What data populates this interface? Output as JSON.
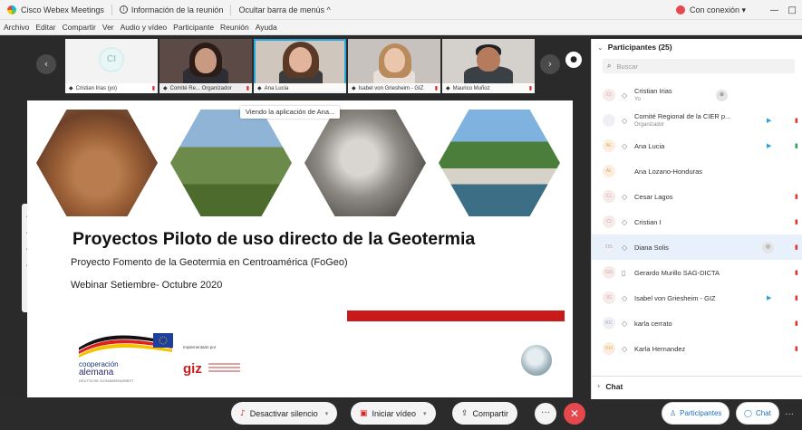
{
  "titlebar": {
    "app_name": "Cisco Webex Meetings",
    "meeting_info": "Información de la reunión",
    "hide_menu": "Ocultar barra de menús ^",
    "connection": "Con conexión ▾",
    "minimize": "—",
    "maximize": "□"
  },
  "menu": [
    "Archivo",
    "Editar",
    "Compartir",
    "Ver",
    "Audio y vídeo",
    "Participante",
    "Reunión",
    "Ayuda"
  ],
  "video_strip": {
    "tiles": [
      {
        "name": "Cristian Irias (yo)",
        "initials": "CI",
        "type": "avatar"
      },
      {
        "name": "Comité Re... Organizador",
        "type": "video"
      },
      {
        "name": "Ana Lucia",
        "type": "video",
        "active": true
      },
      {
        "name": "Isabel von Griesheim - GIZ",
        "type": "video"
      },
      {
        "name": "Maurico Muñoz",
        "type": "video"
      }
    ],
    "left_arrow": "‹",
    "right_arrow": "›",
    "end_icon": "●"
  },
  "viewing_label": "Viendo la aplicación de Ana...",
  "slide": {
    "title": "Proyectos Piloto de uso directo de la Geotermia",
    "subtitle": "Proyecto Fomento de la Geotermia en Centroamérica (FoGeo)",
    "subtitle2": "Webinar Setiembre- Octubre 2020",
    "coop_line1": "cooperación",
    "coop_line2": "alemana",
    "coop_line3": "DEUTSCHE ZUSAMMENARBEIT",
    "implemented_by": "Implementado por",
    "giz": "giz"
  },
  "controls": {
    "mute": "Desactivar silencio",
    "video": "Iniciar vídeo",
    "share": "Compartir",
    "more": "···",
    "end": "✕",
    "participants": "Participantes",
    "chat": "Chat",
    "overflow": "···"
  },
  "panel": {
    "title": "Participantes (25)",
    "search_placeholder": "Buscar",
    "participants": [
      {
        "initials": "CI",
        "name": "Cristian Irias",
        "role": "Yo",
        "circle": "⊕"
      },
      {
        "initials": "",
        "name": "Comité Regional de la CIER p...",
        "role": "Organizador",
        "cam": true,
        "mic": true
      },
      {
        "initials": "AL",
        "name": "Ana Lucia",
        "cam": true,
        "mic": true
      },
      {
        "initials": "AL",
        "name": "Ana Lozano-Honduras"
      },
      {
        "initials": "CL",
        "name": "Cesar Lagos",
        "mic": true
      },
      {
        "initials": "CI",
        "name": "Cristian I",
        "mic": true
      },
      {
        "initials": "DS",
        "name": "Diana Solis",
        "circle": "◎",
        "mic": true,
        "highlight": true
      },
      {
        "initials": "GS",
        "name": "Gerardo Murillo SAG-DICTA",
        "mic": true
      },
      {
        "initials": "IG",
        "name": "Isabel von Griesheim - GIZ",
        "cam": true,
        "mic": true
      },
      {
        "initials": "KC",
        "name": "karla cerrato",
        "mic": true
      },
      {
        "initials": "KH",
        "name": "Karla Hernandez",
        "mic": true
      }
    ],
    "chat_title": "Chat"
  }
}
